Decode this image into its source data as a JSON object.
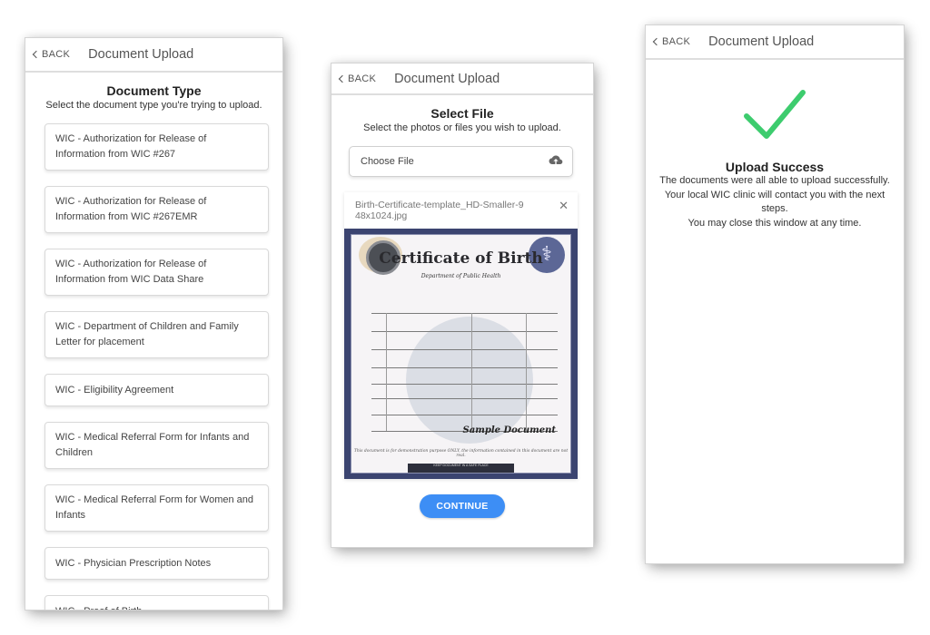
{
  "screens": [
    {
      "header": {
        "back_label": "BACK",
        "title": "Document Upload"
      },
      "section_title": "Document Type",
      "section_subtitle": "Select the document type you're trying to upload.",
      "document_types": [
        "WIC - Authorization for Release of Information from WIC #267",
        "WIC - Authorization for Release of Information from WIC #267EMR",
        "WIC - Authorization for Release of Information from WIC Data Share",
        "WIC - Department of Children and Family Letter for placement",
        "WIC - Eligibility Agreement",
        "WIC - Medical Referral Form for Infants and Children",
        "WIC - Medical Referral Form for Women and Infants",
        "WIC - Physician Prescription Notes",
        "WIC - Proof of Birth"
      ]
    },
    {
      "header": {
        "back_label": "BACK",
        "title": "Document Upload"
      },
      "section_title": "Select File",
      "section_subtitle": "Select the photos or files you wish to upload.",
      "choose_file_label": "Choose File",
      "choose_file_icon": "cloud-upload-icon",
      "selected_file": {
        "name": "Birth-Certificate-template_HD-Smaller-948x1024.jpg",
        "remove_icon": "close-icon",
        "preview": {
          "title": "Certificate of Birth",
          "department": "Department of Public Health",
          "watermark_label": "Sample Document",
          "note": "This document is for demonstration purpose ONLY, the information contained in this document are not real.",
          "band_text": "KEEP DOCUMENT IN A SAFE PLACE"
        }
      },
      "continue_label": "CONTINUE",
      "colors": {
        "primary": "#3d8ef5"
      }
    },
    {
      "header": {
        "back_label": "BACK",
        "title": "Document Upload"
      },
      "status_icon": "checkmark-icon",
      "success_title": "Upload Success",
      "success_lines": [
        "The documents were all able to upload successfully.",
        "Your local WIC clinic will contact you with the next steps.",
        "You may close this window at any time."
      ],
      "colors": {
        "success": "#3dcc6e"
      }
    }
  ]
}
